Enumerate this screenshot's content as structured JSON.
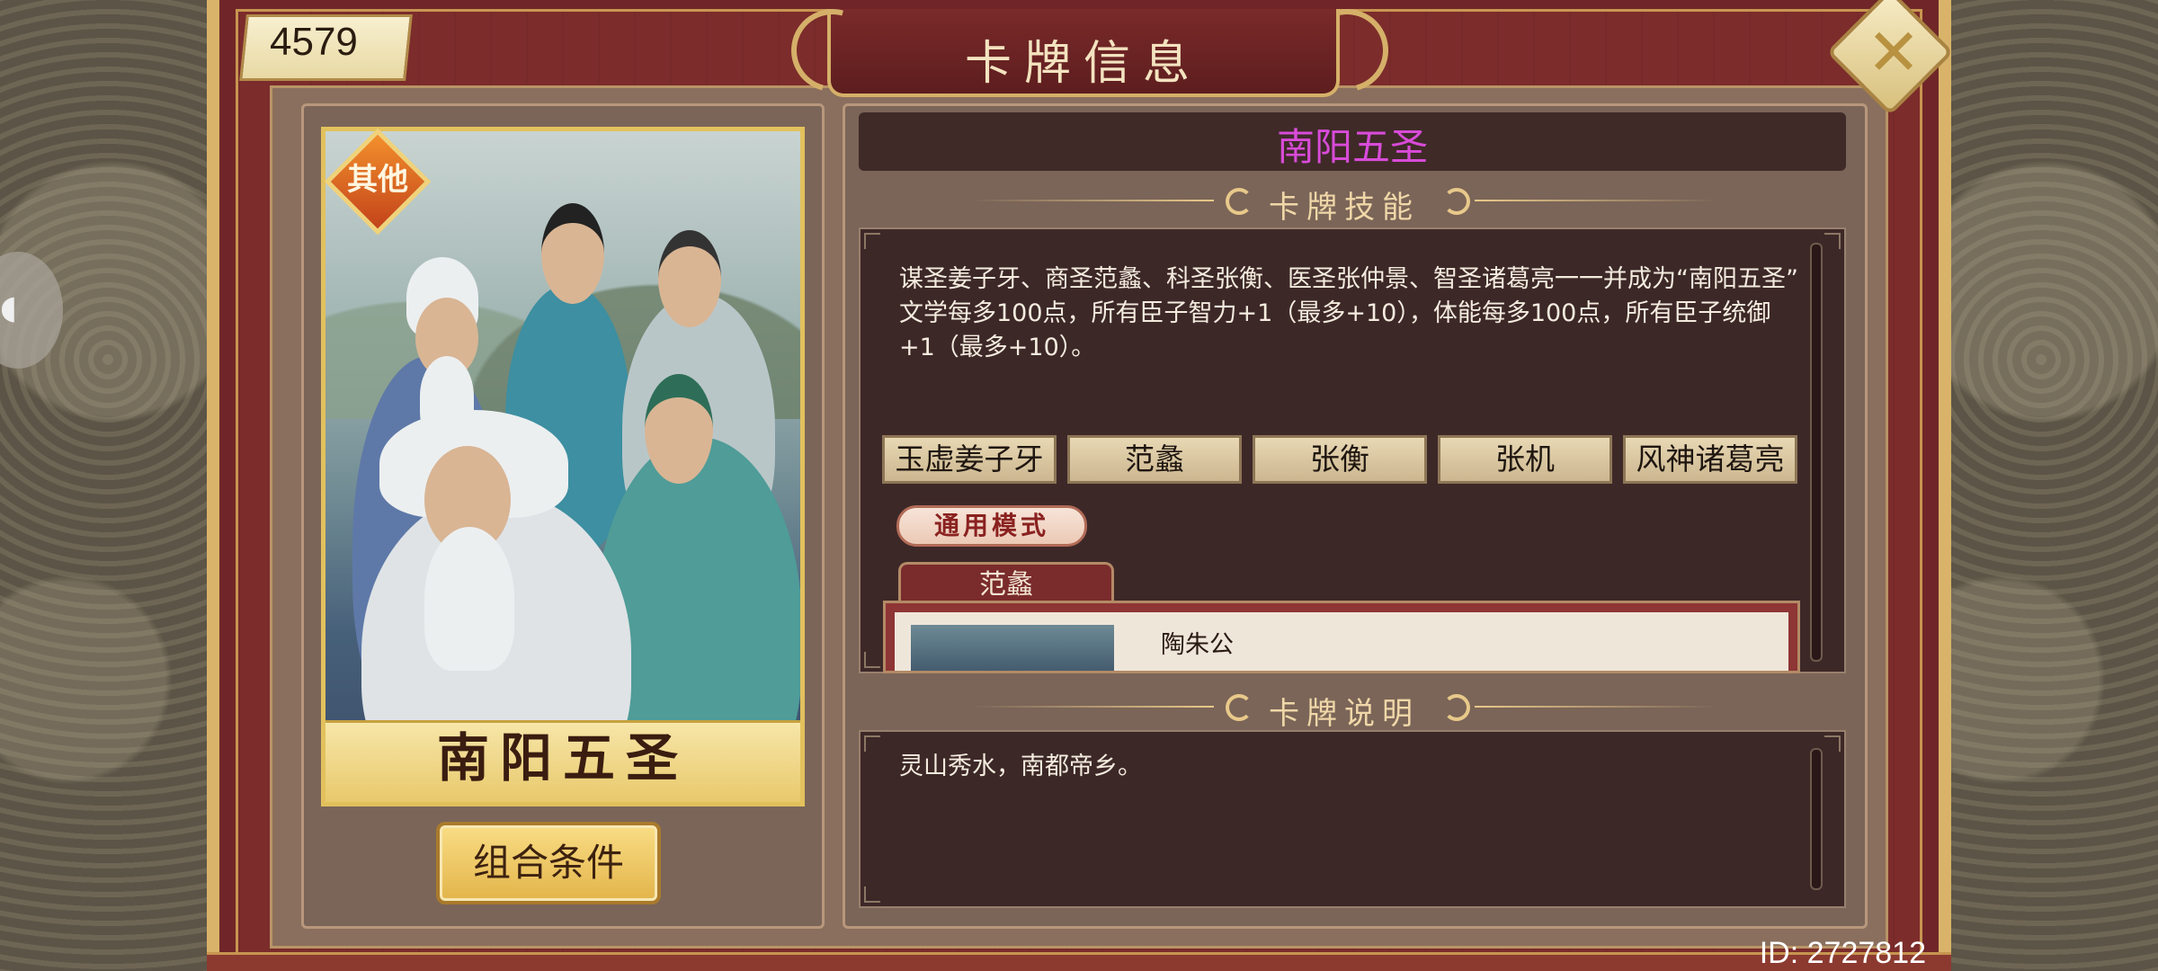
{
  "score": "4579",
  "title": "卡牌信息",
  "close_icon": "close-icon",
  "card": {
    "badge": "其他",
    "name": "南阳五圣",
    "combo_button": "组合条件"
  },
  "info": {
    "name": "南阳五圣",
    "name_color": "#d84bd8",
    "skills_header": "卡牌技能",
    "skill_description": "谋圣姜子牙、商圣范蠡、科圣张衡、医圣张仲景、智圣诸葛亮一一并成为“南阳五圣”\n文学每多100点，所有臣子智力+1（最多+10），体能每多100点，所有臣子统御+1（最多+10）。",
    "members": [
      "玉虚姜子牙",
      "范蠡",
      "张衡",
      "张机",
      "风神诸葛亮"
    ],
    "mode_tag": "通用模式",
    "sub_tab": "范蠡",
    "sub_item_name": "陶朱公",
    "desc_header": "卡牌说明",
    "desc_text": "灵山秀水，南都帝乡。"
  },
  "footer": {
    "id_label": "ID: 2727812"
  }
}
